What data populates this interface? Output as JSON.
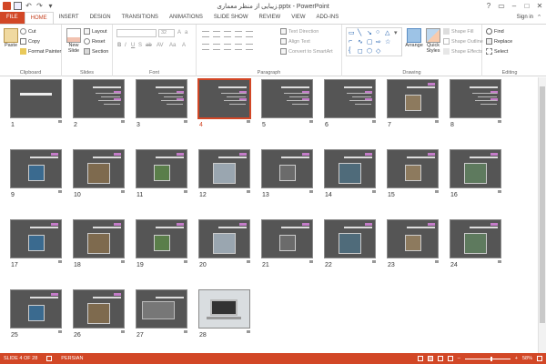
{
  "app": {
    "title": "زیبایی از منظر معماری.pptx - PowerPoint",
    "signin": "Sign in",
    "help": "?"
  },
  "tabs": [
    "FILE",
    "HOME",
    "INSERT",
    "DESIGN",
    "TRANSITIONS",
    "ANIMATIONS",
    "SLIDE SHOW",
    "REVIEW",
    "VIEW",
    "ADD-INS"
  ],
  "active_tab": "HOME",
  "ribbon": {
    "clipboard": {
      "label": "Clipboard",
      "paste": "Paste",
      "cut": "Cut",
      "copy": "Copy",
      "format_painter": "Format Painter"
    },
    "slides": {
      "label": "Slides",
      "new_slide": "New",
      "new_slide_2": "Slide",
      "layout": "Layout",
      "reset": "Reset",
      "section": "Section"
    },
    "font": {
      "label": "Font",
      "size": "32"
    },
    "paragraph": {
      "label": "Paragraph",
      "text_direction": "Text Direction",
      "align_text": "Align Text",
      "convert": "Convert to SmartArt"
    },
    "drawing": {
      "label": "Drawing",
      "arrange": "Arrange",
      "quick_styles": "Quick",
      "quick_styles_2": "Styles",
      "shape_fill": "Shape Fill",
      "shape_outline": "Shape Outline",
      "shape_effects": "Shape Effects"
    },
    "editing": {
      "label": "Editing",
      "find": "Find",
      "replace": "Replace",
      "select": "Select"
    }
  },
  "slides": {
    "selected": 4,
    "numbers": [
      "1",
      "2",
      "3",
      "4",
      "5",
      "6",
      "7",
      "8",
      "9",
      "10",
      "11",
      "12",
      "13",
      "14",
      "15",
      "16",
      "17",
      "18",
      "19",
      "20",
      "21",
      "22",
      "23",
      "24",
      "25",
      "26",
      "27",
      "28"
    ]
  },
  "status": {
    "slide_info": "SLIDE 4 OF 28",
    "language": "PERSIAN",
    "zoom": "58%",
    "zoom_level": 0.58
  }
}
